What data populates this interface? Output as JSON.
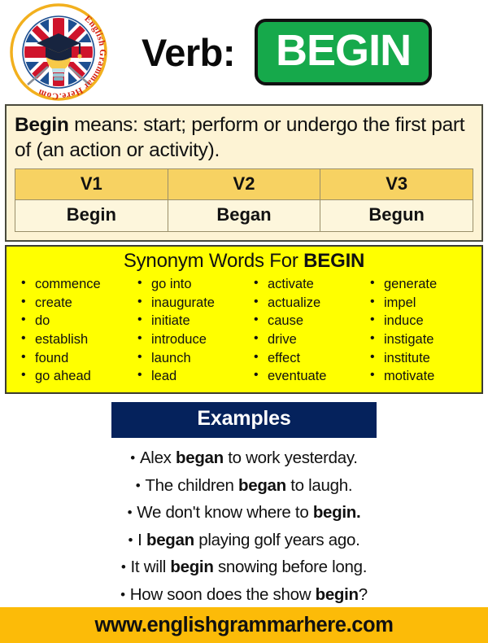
{
  "brand": {
    "logo_alt": "English Grammar Here.Com",
    "logo_ring_text": "English Grammar Here.Com",
    "ring_text_color": "#d62111",
    "rim_color": "#f2b01e"
  },
  "header": {
    "verb_label": "Verb:",
    "verb_name": "BEGIN",
    "badge_color": "#16a94b",
    "badge_border_color": "#111111",
    "badge_text_color": "#ffffff"
  },
  "definition": {
    "word": "Begin",
    "rest": " means: start; perform or undergo the first part of (an action or activity).",
    "panel_color": "#fdf3d4"
  },
  "forms_table": {
    "headers": [
      "V1",
      "V2",
      "V3"
    ],
    "values": [
      "Begin",
      "Began",
      "Begun"
    ],
    "header_color": "#f7d262",
    "cell_color": "#fdf6dc"
  },
  "synonyms": {
    "title_prefix": "Synonym Words For ",
    "title_word": "BEGIN",
    "panel_color": "#ffff00",
    "columns": [
      [
        "commence",
        "create",
        "do",
        "establish",
        "found",
        "go ahead"
      ],
      [
        "go into",
        "inaugurate",
        "initiate",
        "introduce",
        "launch",
        "lead"
      ],
      [
        "activate",
        "actualize",
        "cause",
        "drive",
        "effect",
        "eventuate"
      ],
      [
        "generate",
        "impel",
        "induce",
        "instigate",
        "institute",
        "motivate"
      ]
    ]
  },
  "examples": {
    "banner_label": "Examples",
    "banner_color": "#05225c",
    "bullet": "•",
    "items": [
      {
        "before": "Alex ",
        "bold": "began",
        "after": " to work yesterday."
      },
      {
        "before": "The children ",
        "bold": "began",
        "after": " to laugh."
      },
      {
        "before": "We don't know where to ",
        "bold": "begin.",
        "after": ""
      },
      {
        "before": "I ",
        "bold": "began",
        "after": " playing golf years ago."
      },
      {
        "before": "It will ",
        "bold": "begin",
        "after": " snowing before long."
      },
      {
        "before": "How soon does the show ",
        "bold": "begin",
        "after": "?"
      }
    ]
  },
  "footer": {
    "url": "www.englishgrammarhere.com",
    "background_color": "#fcbb08"
  }
}
